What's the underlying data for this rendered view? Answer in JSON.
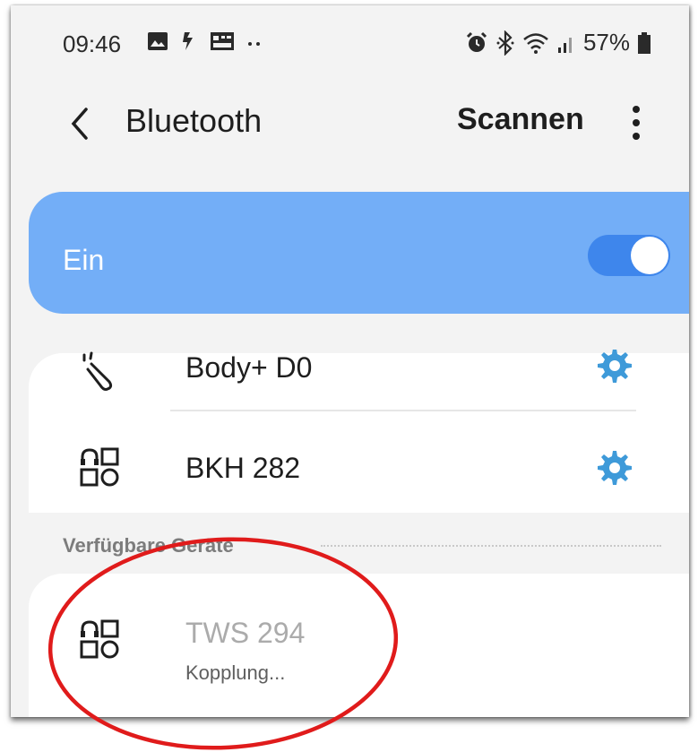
{
  "status_bar": {
    "time": "09:46",
    "battery_percent": "57%",
    "icons_left": [
      "gallery-icon",
      "notification-icon",
      "calendar-icon",
      "more-dots-icon"
    ],
    "icons_right": [
      "alarm-icon",
      "bluetooth-icon",
      "wifi-icon",
      "signal-icon",
      "battery-icon"
    ]
  },
  "header": {
    "title": "Bluetooth",
    "scan_label": "Scannen",
    "back_icon": "chevron-left-icon",
    "more_icon": "more-vertical-icon"
  },
  "toggle": {
    "label": "Ein",
    "state": "on",
    "colors": {
      "card": "#73aef7",
      "track": "#3e86ec",
      "knob": "#ffffff"
    }
  },
  "paired_devices": [
    {
      "name": "Body+ D0",
      "icon": "wearable-icon",
      "settings_icon": "gear-icon"
    },
    {
      "name": "BKH 282",
      "icon": "device-generic-icon",
      "settings_icon": "gear-icon"
    }
  ],
  "available_section": {
    "title": "Verfügbare Geräte"
  },
  "available_devices": [
    {
      "name": "TWS 294",
      "status": "Kopplung...",
      "icon": "device-generic-icon"
    }
  ],
  "colors": {
    "accent": "#3e9ad9",
    "annotation": "#e01b1b",
    "background": "#f3f3f3"
  }
}
